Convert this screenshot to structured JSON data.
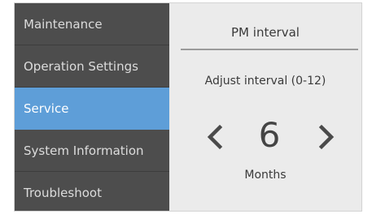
{
  "sidebar": {
    "items": [
      {
        "label": "Maintenance",
        "selected": false
      },
      {
        "label": "Operation Settings",
        "selected": false
      },
      {
        "label": "Service",
        "selected": true
      },
      {
        "label": "System Information",
        "selected": false
      },
      {
        "label": "Troubleshoot",
        "selected": false
      }
    ]
  },
  "panel": {
    "title": "PM interval",
    "hint": "Adjust interval (0-12)",
    "value": "6",
    "unit": "Months",
    "decrement_icon": "chevron-left-icon",
    "increment_icon": "chevron-right-icon"
  },
  "colors": {
    "sidebar_bg": "#4d4d4d",
    "selected_bg": "#5e9ed8",
    "content_bg": "#ebebeb"
  }
}
